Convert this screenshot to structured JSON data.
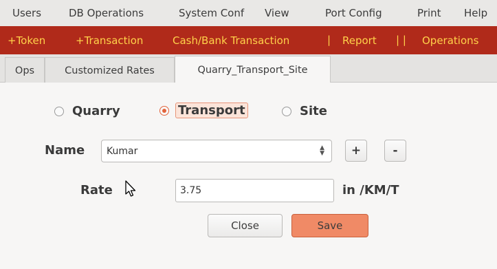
{
  "menubar": {
    "items": [
      {
        "label": "Users",
        "mnemonic": "U"
      },
      {
        "label": "DB Operations",
        "mnemonic": "D"
      },
      {
        "label": "System Conf",
        "mnemonic": "S"
      },
      {
        "label": "View",
        "mnemonic": "V"
      },
      {
        "label": "Port Config",
        "mnemonic": "g"
      },
      {
        "label": "Print",
        "mnemonic": "P"
      },
      {
        "label": "Help",
        "mnemonic": "H"
      }
    ]
  },
  "toolbar": {
    "token": "+Token",
    "transaction": "+Transaction",
    "cash_bank": "Cash/Bank Transaction",
    "sep1": "|",
    "report": "Report",
    "sep2": "| |",
    "operations": "Operations"
  },
  "tabs": [
    {
      "label": "Ops",
      "active": false
    },
    {
      "label": "Customized Rates",
      "active": false
    },
    {
      "label": "Quarry_Transport_Site",
      "active": true
    }
  ],
  "form": {
    "radios": [
      {
        "label": "Quarry",
        "checked": false
      },
      {
        "label": "Transport",
        "checked": true
      },
      {
        "label": "Site",
        "checked": false
      }
    ],
    "name_label": "Name",
    "name_value": "Kumar",
    "add_label": "+",
    "remove_label": "-",
    "rate_label": "Rate",
    "rate_value": "3.75",
    "rate_unit": "in /KM/T",
    "close_label": "Close",
    "save_label": "Save"
  },
  "colors": {
    "toolbar_bg": "#b02a1a",
    "toolbar_text": "#ffd24a",
    "accent": "#e2643c",
    "save_bg": "#f08a66"
  }
}
